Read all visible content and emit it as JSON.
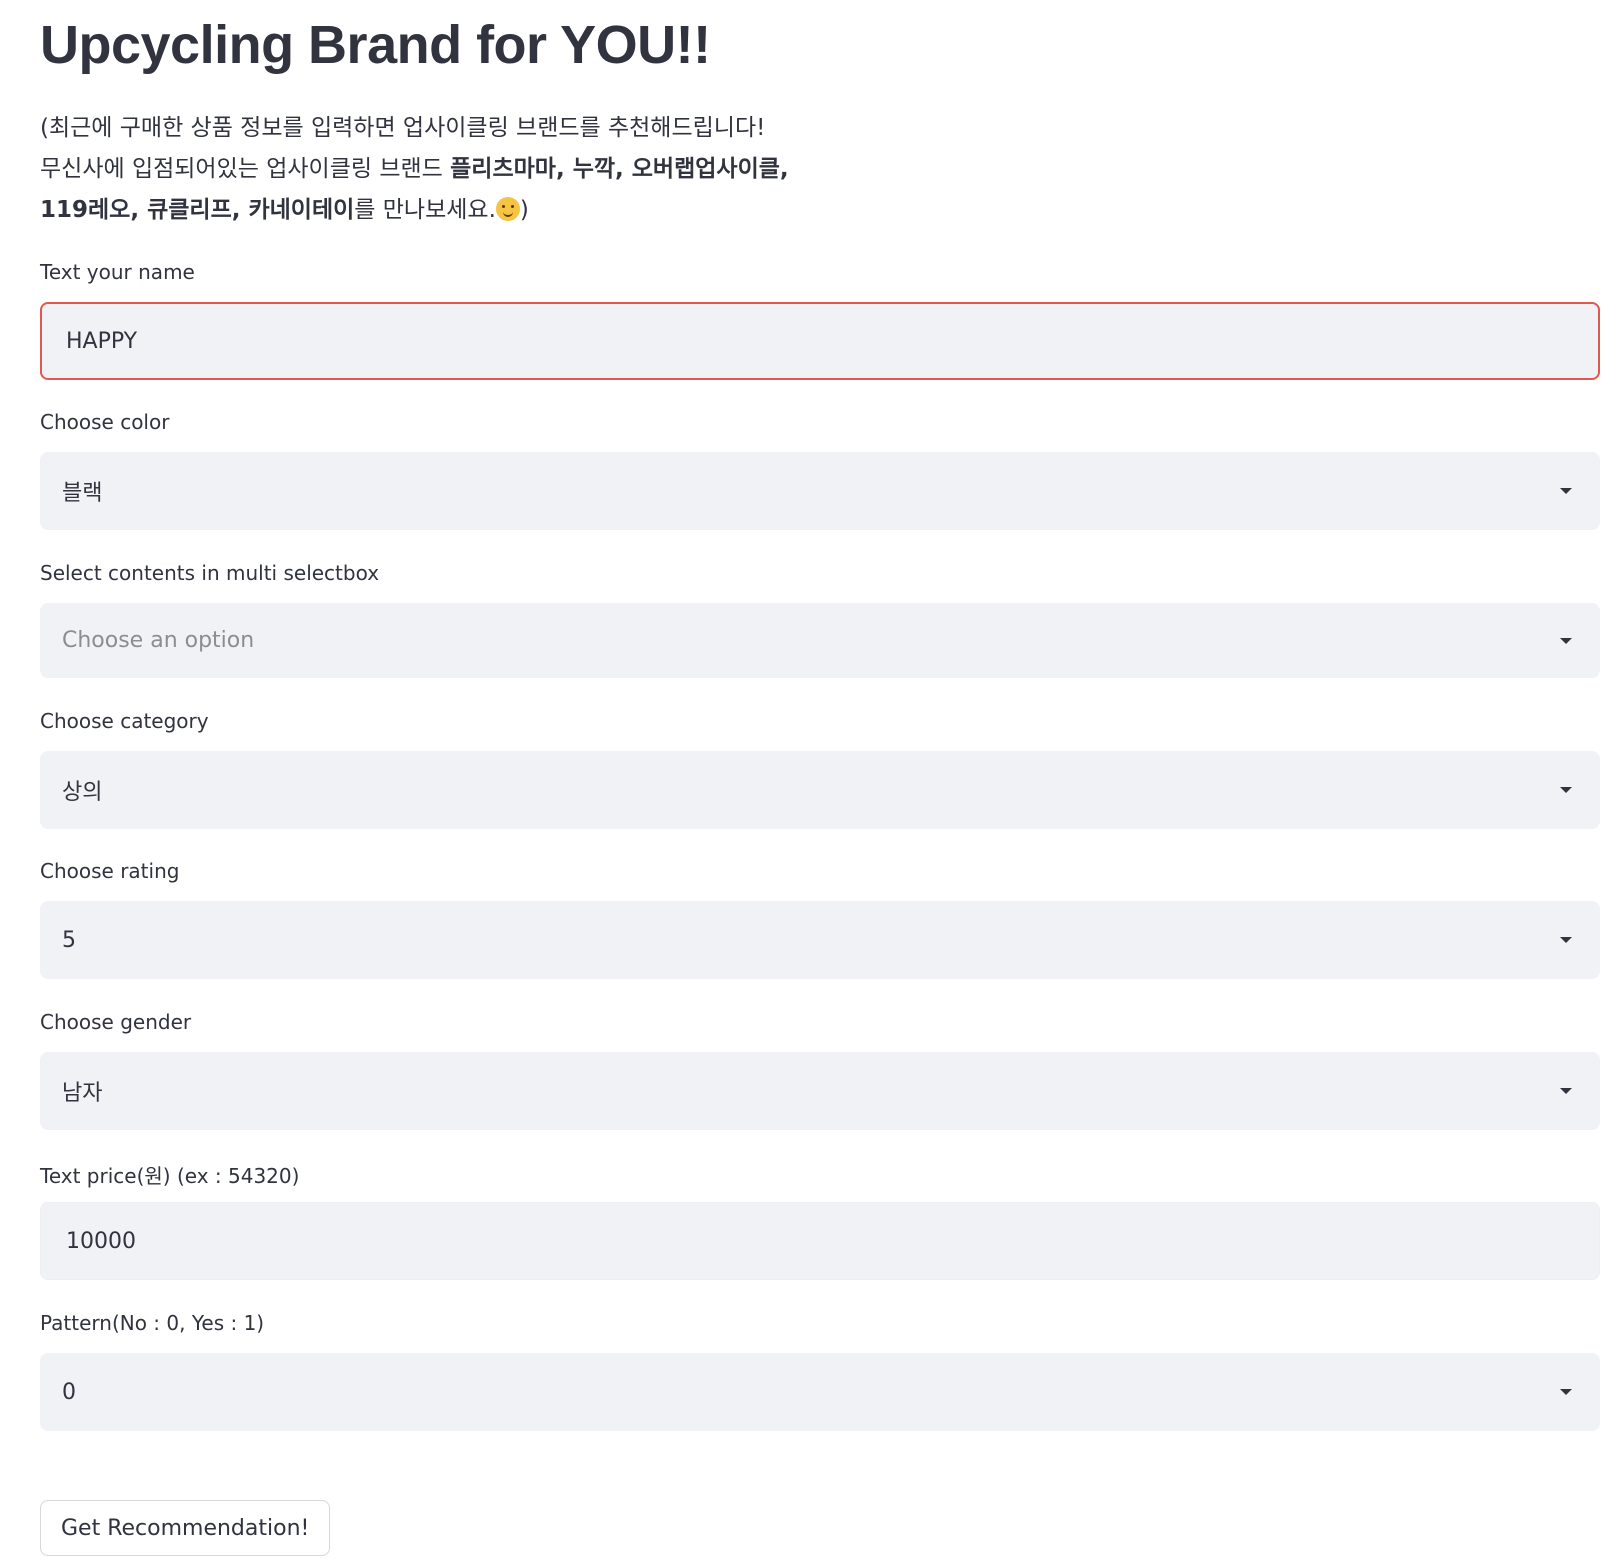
{
  "title": "Upcycling Brand for YOU!!",
  "intro": {
    "line1": "(최근에 구매한 상품 정보를 입력하면 업사이클링 브랜드를 추천해드립니다!",
    "line2_prefix": "무신사에 입점되어있는 업사이클링 브랜드 ",
    "brand1": "플리츠마마",
    "sep1": ", ",
    "brand2": "누깍",
    "sep2": ", ",
    "brand3": "오버랩업사이클",
    "sep3": ",",
    "brand4": "119레오",
    "sep4": ", ",
    "brand5": "큐클리프",
    "sep5": ", ",
    "brand6": "카네이테이",
    "line3_suffix": "를 만나보세요.",
    "emoji_name": "hugging-face-icon",
    "closing": ")"
  },
  "fields": {
    "name": {
      "label": "Text your name",
      "value": "HAPPY"
    },
    "color": {
      "label": "Choose color",
      "value": "블랙"
    },
    "multi": {
      "label": "Select contents in multi selectbox",
      "placeholder": "Choose an option"
    },
    "category": {
      "label": "Choose category",
      "value": "상의"
    },
    "rating": {
      "label": "Choose rating",
      "value": "5"
    },
    "gender": {
      "label": "Choose gender",
      "value": "남자"
    },
    "price": {
      "label": "Text price(원) (ex : 54320)",
      "value": "10000"
    },
    "pattern": {
      "label": "Pattern(No : 0, Yes : 1)",
      "value": "0"
    }
  },
  "button": {
    "label": "Get Recommendation!"
  },
  "colors": {
    "text": "#31333f",
    "field_bg": "#f0f2f6",
    "focus_border": "#e0584e",
    "placeholder": "#8b8d94"
  }
}
